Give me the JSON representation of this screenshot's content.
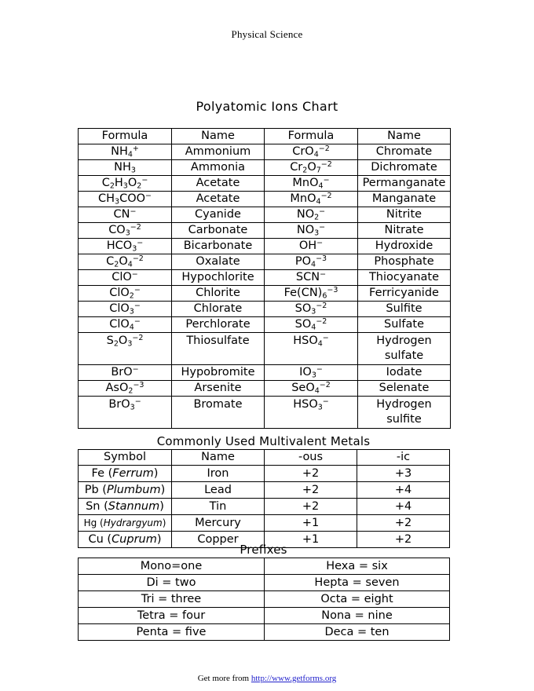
{
  "header": {
    "course": "Physical Science"
  },
  "doc_title": "Polyatomic Ions Chart",
  "ions_table": {
    "columns": [
      "Formula",
      "Name",
      "Formula",
      "Name"
    ],
    "rows": [
      {
        "f1": "NH4+",
        "n1": "Ammonium",
        "f2": "CrO4-2",
        "n2": "Chromate"
      },
      {
        "f1": "NH3",
        "n1": "Ammonia",
        "f2": "Cr2O7-2",
        "n2": "Dichromate"
      },
      {
        "f1": "C2H3O2-",
        "n1": "Acetate",
        "f2": "MnO4-",
        "n2": "Permanganate"
      },
      {
        "f1": "CH3COO-",
        "n1": "Acetate",
        "f2": "MnO4-2",
        "n2": "Manganate"
      },
      {
        "f1": "CN-",
        "n1": "Cyanide",
        "f2": "NO2-",
        "n2": "Nitrite"
      },
      {
        "f1": "CO3-2",
        "n1": "Carbonate",
        "f2": "NO3-",
        "n2": "Nitrate"
      },
      {
        "f1": "HCO3-",
        "n1": "Bicarbonate",
        "f2": "OH-",
        "n2": "Hydroxide"
      },
      {
        "f1": "C2O4-2",
        "n1": "Oxalate",
        "f2": "PO4-3",
        "n2": "Phosphate"
      },
      {
        "f1": "ClO-",
        "n1": "Hypochlorite",
        "f2": "SCN-",
        "n2": "Thiocyanate"
      },
      {
        "f1": "ClO2-",
        "n1": "Chlorite",
        "f2": "Fe(CN)6-3",
        "n2": "Ferricyanide"
      },
      {
        "f1": "ClO3-",
        "n1": "Chlorate",
        "f2": "SO3-2",
        "n2": "Sulfite"
      },
      {
        "f1": "ClO4-",
        "n1": "Perchlorate",
        "f2": "SO4-2",
        "n2": "Sulfate"
      },
      {
        "f1": "S2O3-2",
        "n1": "Thiosulfate",
        "f2": "HSO4-",
        "n2": "Hydrogen sulfate",
        "tall": true
      },
      {
        "f1": "BrO-",
        "n1": "Hypobromite",
        "f2": "IO3-",
        "n2": "Iodate"
      },
      {
        "f1": "AsO2-3",
        "n1": "Arsenite",
        "f2": "SeO4-2",
        "n2": "Selenate"
      },
      {
        "f1": "BrO3-",
        "n1": "Bromate",
        "f2": "HSO3-",
        "n2": "Hydrogen sulfite",
        "tall": true
      }
    ]
  },
  "metals": {
    "title": "Commonly Used Multivalent Metals",
    "columns": [
      "Symbol",
      "Name",
      "-ous",
      "-ic"
    ],
    "rows": [
      {
        "symbol_prefix": "Fe (",
        "latin": "Ferrum",
        "symbol_suffix": ")",
        "name": "Iron",
        "ous": "+2",
        "ic": "+3"
      },
      {
        "symbol_prefix": "Pb (",
        "latin": "Plumbum",
        "symbol_suffix": ")",
        "name": "Lead",
        "ous": "+2",
        "ic": "+4"
      },
      {
        "symbol_prefix": "Sn (",
        "latin": "Stannum",
        "symbol_suffix": ")",
        "name": "Tin",
        "ous": "+2",
        "ic": "+4"
      },
      {
        "symbol_prefix": "Hg (",
        "latin": "Hydrargyum",
        "symbol_suffix": ")",
        "name": "Mercury",
        "ous": "+1",
        "ic": "+2",
        "small": true
      },
      {
        "symbol_prefix": "Cu (",
        "latin": "Cuprum",
        "symbol_suffix": ")",
        "name": "Copper",
        "ous": "+1",
        "ic": "+2"
      }
    ]
  },
  "prefixes": {
    "title": "Prefixes",
    "rows": [
      {
        "left": "Mono=one",
        "right": "Hexa = six"
      },
      {
        "left": "Di = two",
        "right": "Hepta = seven"
      },
      {
        "left": "Tri = three",
        "right": "Octa = eight"
      },
      {
        "left": "Tetra = four",
        "right": "Nona = nine"
      },
      {
        "left": "Penta = five",
        "right": "Deca = ten"
      }
    ]
  },
  "footer": {
    "text": "Get more from ",
    "url": "http://www.getforms.org"
  }
}
